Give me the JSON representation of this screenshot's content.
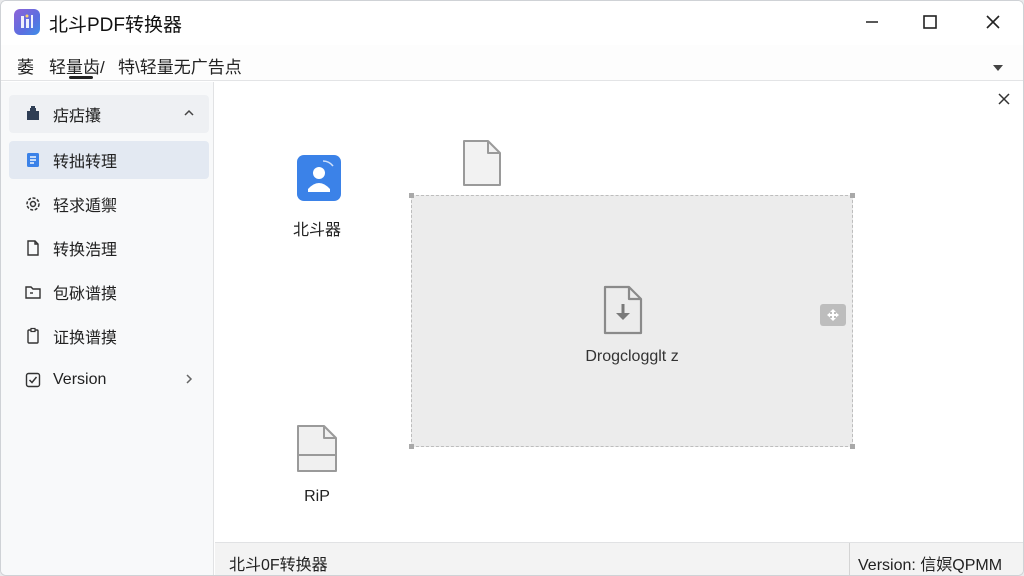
{
  "window": {
    "title": "北斗PDF转换器",
    "controls": {
      "minimize": "minimize-icon",
      "maximize": "maximize-icon",
      "close": "close-icon"
    }
  },
  "menubar": {
    "items": [
      "萎",
      "轻量齿/",
      "特\\轻量无广告点"
    ]
  },
  "sidebar": {
    "items": [
      {
        "label": "痁痁攮",
        "icon": "puzzle-icon",
        "chevron": "chevron-up-icon"
      },
      {
        "label": "转拙转理",
        "icon": "document-list-icon"
      },
      {
        "label": "轻求遁禦",
        "icon": "gear-icon"
      },
      {
        "label": "转换浩理",
        "icon": "file-icon"
      },
      {
        "label": "包砯谱摸",
        "icon": "folder-icon"
      },
      {
        "label": "证换谱摸",
        "icon": "clipboard-icon"
      },
      {
        "label": "Version",
        "icon": "checkbox-icon",
        "chevron": "chevron-right-icon"
      }
    ]
  },
  "main": {
    "tiles": [
      {
        "label": "北斗器",
        "icon": "user-app-icon"
      },
      {
        "label": "",
        "icon": "blank-file-icon"
      },
      {
        "label": "RiP",
        "icon": "file-table-icon"
      }
    ],
    "dropzone": {
      "label": "Drogclogglt z",
      "icon": "file-download-icon"
    }
  },
  "statusbar": {
    "left": "北斗0F转换器",
    "right": "Version: 信嫇QPMM"
  },
  "colors": {
    "accent": "#3b82e8",
    "sidebar_active": "#e3e9f2",
    "dropzone": "#ececec"
  }
}
